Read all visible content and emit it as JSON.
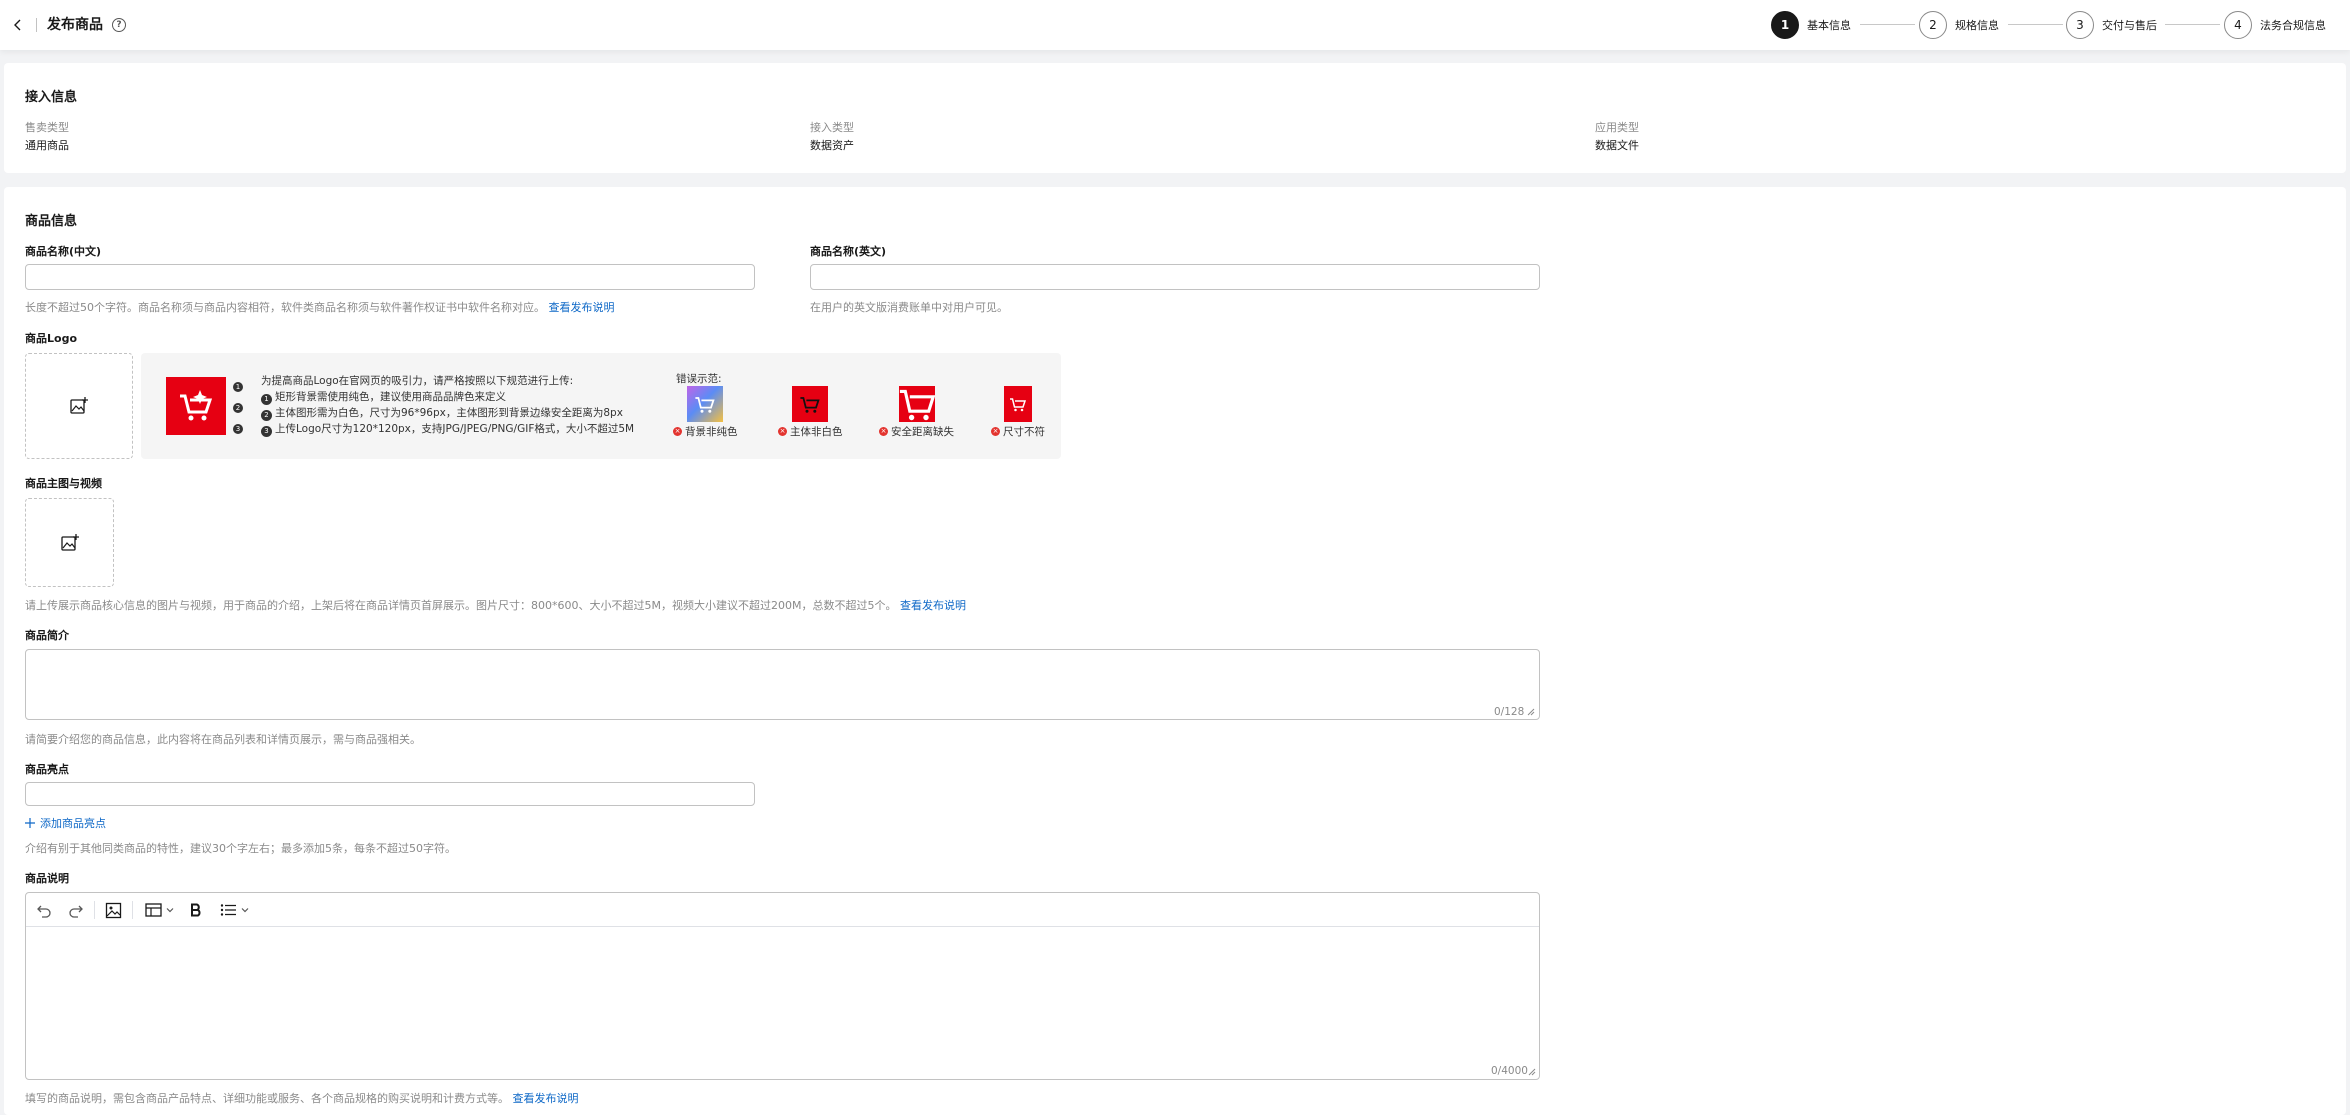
{
  "header": {
    "title": "发布商品",
    "steps": [
      {
        "num": "1",
        "label": "基本信息",
        "active": true
      },
      {
        "num": "2",
        "label": "规格信息",
        "active": false
      },
      {
        "num": "3",
        "label": "交付与售后",
        "active": false
      },
      {
        "num": "4",
        "label": "法务合规信息",
        "active": false
      }
    ]
  },
  "access_info": {
    "title": "接入信息",
    "fields": [
      {
        "label": "售卖类型",
        "value": "通用商品"
      },
      {
        "label": "接入类型",
        "value": "数据资产"
      },
      {
        "label": "应用类型",
        "value": "数据文件"
      }
    ]
  },
  "product_info": {
    "title": "商品信息",
    "name_cn": {
      "label": "商品名称(中文)",
      "value": "",
      "hint": "长度不超过50个字符。商品名称须与商品内容相符，软件类商品名称须与软件著作权证书中软件名称对应。",
      "hint_link": "查看发布说明"
    },
    "name_en": {
      "label": "商品名称(英文)",
      "value": "",
      "hint": "在用户的英文版消费账单中对用户可见。"
    },
    "logo": {
      "label": "商品Logo",
      "guide": {
        "intro": "为提高商品Logo在官网页的吸引力，请严格按照以下规范进行上传:",
        "rules": [
          {
            "n": "1",
            "text": "矩形背景需使用纯色，建议使用商品品牌色来定义"
          },
          {
            "n": "2",
            "text": "主体图形需为白色，尺寸为96*96px，主体图形到背景边缘安全距离为8px"
          },
          {
            "n": "3",
            "text": "上传Logo尺寸为120*120px，支持JPG/JPEG/PNG/GIF格式，大小不超过5M"
          }
        ],
        "markers": [
          "1",
          "2",
          "3"
        ],
        "error_title": "错误示范:",
        "errors": [
          "背景非纯色",
          "主体非白色",
          "安全距离缺失",
          "尺寸不符"
        ],
        "error_mark": "×"
      }
    },
    "media": {
      "label": "商品主图与视频",
      "hint": "请上传展示商品核心信息的图片与视频，用于商品的介绍，上架后将在商品详情页首屏展示。图片尺寸：800*600、大小不超过5M，视频大小建议不超过200M，总数不超过5个。",
      "hint_link": "查看发布说明"
    },
    "intro": {
      "label": "商品简介",
      "value": "",
      "counter": "0/128",
      "hint": "请简要介绍您的商品信息，此内容将在商品列表和详情页展示，需与商品强相关。"
    },
    "highlights": {
      "label": "商品亮点",
      "value": "",
      "add_label": "添加商品亮点",
      "hint": "介绍有别于其他同类商品的特性，建议30个字左右；最多添加5条，每条不超过50字符。"
    },
    "description": {
      "label": "商品说明",
      "value": "",
      "counter": "0/4000",
      "hint": "填写的商品说明，需包含商品产品特点、详细功能或服务、各个商品规格的购买说明和计费方式等。",
      "hint_link": "查看发布说明"
    }
  },
  "colors": {
    "brand_red": "#e60012",
    "link": "#0e68c7"
  }
}
